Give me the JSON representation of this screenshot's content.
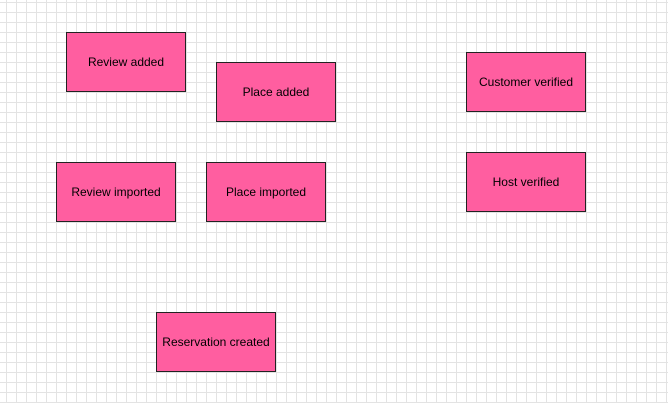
{
  "sticky_color": "#ff5ea0",
  "grid_color": "#e3e3e3",
  "events": [
    {
      "label": "Review added"
    },
    {
      "label": "Place added"
    },
    {
      "label": "Customer verified"
    },
    {
      "label": "Review imported"
    },
    {
      "label": "Place imported"
    },
    {
      "label": "Host verified"
    },
    {
      "label": "Reservation created"
    }
  ]
}
